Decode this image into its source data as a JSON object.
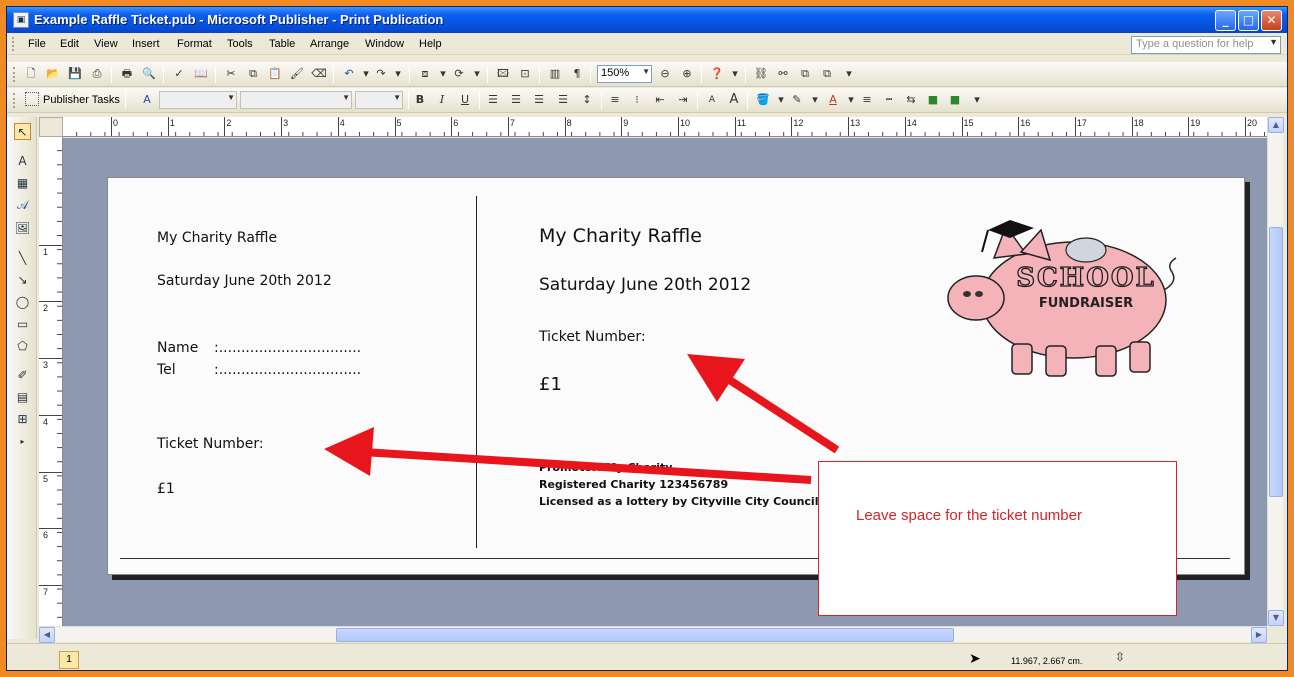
{
  "window": {
    "title": "Example Raffle Ticket.pub - Microsoft Publisher - Print Publication",
    "controls": {
      "minimize": "_",
      "maximize": "□",
      "close": "✕"
    }
  },
  "menu": {
    "items": [
      "File",
      "Edit",
      "View",
      "Insert",
      "Format",
      "Tools",
      "Table",
      "Arrange",
      "Window",
      "Help"
    ],
    "ask_placeholder": "Type a question for help"
  },
  "standard_toolbar": {
    "zoom": "150%"
  },
  "formatting_toolbar": {
    "publisher_tasks": "Publisher Tasks",
    "style": "",
    "font": "",
    "size": "",
    "bold": "B",
    "italic": "I",
    "underline": "U"
  },
  "ruler": {
    "top_numbers": [
      "0",
      "1",
      "2",
      "3",
      "4",
      "5",
      "6",
      "7",
      "8",
      "9",
      "10",
      "11",
      "12",
      "13",
      "14",
      "15",
      "16",
      "17",
      "18",
      "19",
      "20"
    ],
    "left_numbers": [
      "1",
      "2",
      "3",
      "4",
      "5",
      "6",
      "7"
    ]
  },
  "ticket": {
    "stub": {
      "title": "My Charity Raffle",
      "date": "Saturday June 20th 2012",
      "name_label": "Name",
      "name_line": ":................................",
      "tel_label": "Tel",
      "tel_line": ":................................",
      "number_label": "Ticket Number:",
      "price": "£1"
    },
    "main": {
      "title": "My Charity Raffle",
      "date": "Saturday June 20th 2012",
      "number_label": "Ticket Number:",
      "price": "£1",
      "promoter": "Promotor: My Charity",
      "charity": "Registered Charity 123456789",
      "license": "Licensed as a lottery by Cityville City Council"
    },
    "logo": {
      "line1": "SCHOOL",
      "line2": "FUNDRAISER"
    },
    "callout": "Leave space for the ticket number"
  },
  "colors": {
    "arrow": "#e8161c",
    "callout_border": "#d0262a",
    "workspace": "#8e98b0",
    "pig": "#f4b3b8"
  },
  "status": {
    "page": "1",
    "coordinates": "11.967, 2.667 cm."
  }
}
